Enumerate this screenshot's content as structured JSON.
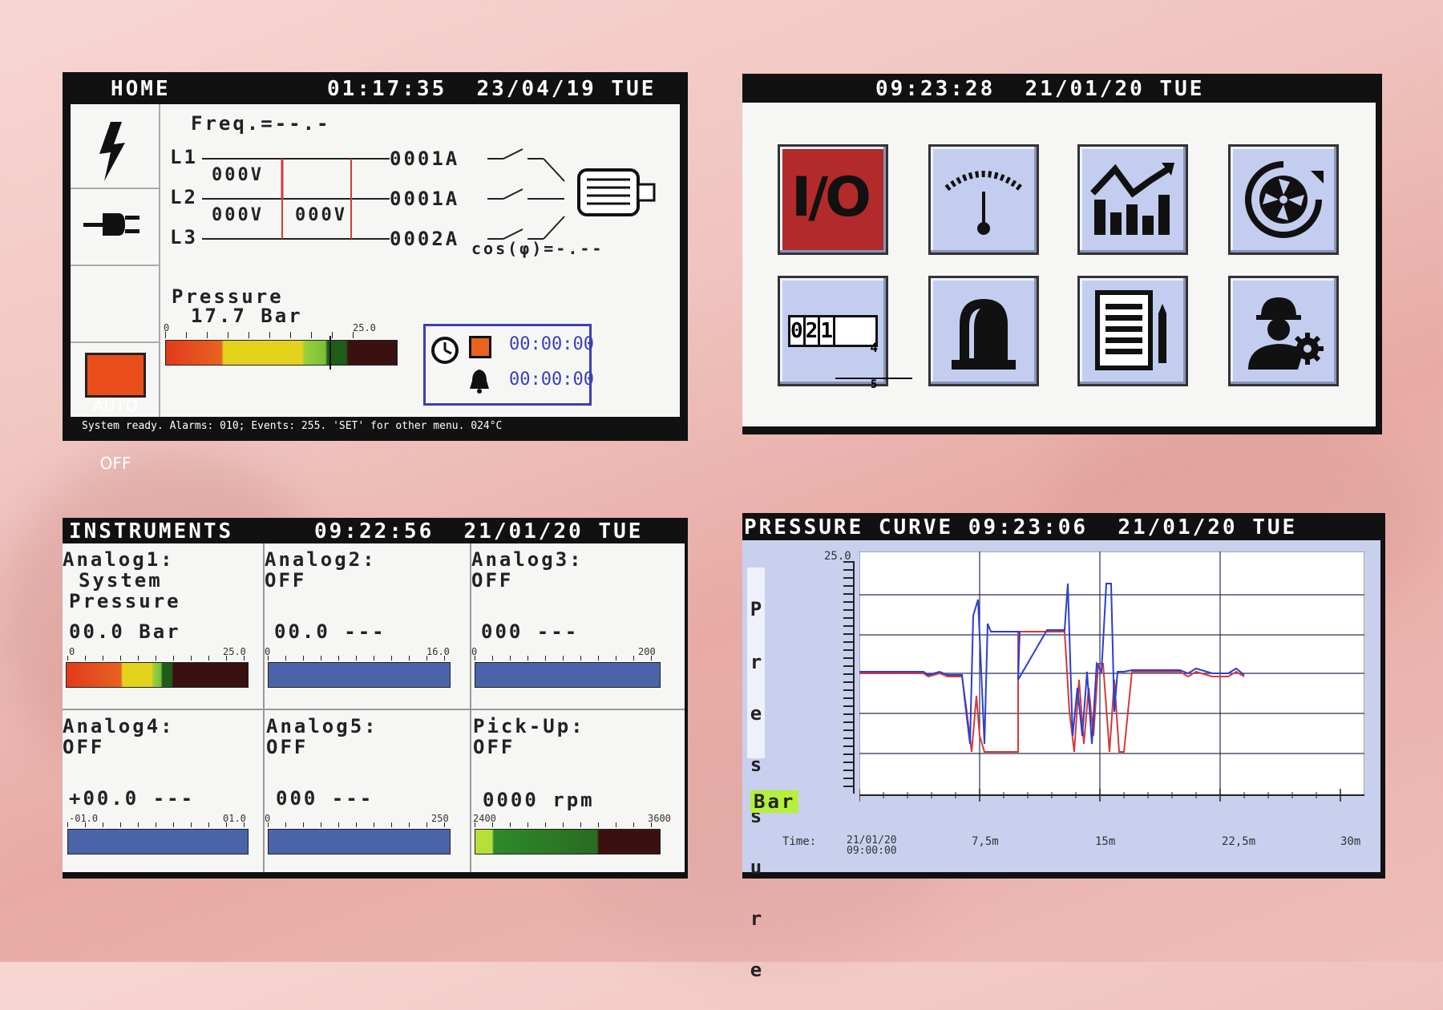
{
  "home": {
    "title": "HOME",
    "clock": "01:17:35  23/04/19 TUE",
    "freq": "Freq.=--.-",
    "l1": "L1",
    "l2": "L2",
    "l3": "L3",
    "v12": "000V",
    "v23": "000V",
    "v31": "000V",
    "i1": "0001A",
    "i2": "0001A",
    "i3": "0002A",
    "cosphi": "cos(φ)=-.--",
    "pressure_label": "Pressure",
    "pressure_value": "17.7 Bar",
    "gauge_min": "0",
    "gauge_max": "25.0",
    "gauge_level": 0.708,
    "auto_label": "AUTO",
    "off_label": "OFF",
    "timer1": "00:00:00",
    "timer2": "00:00:00",
    "status_bar": "System ready. Alarms: 010; Events: 255. 'SET' for other menu. 024°C"
  },
  "menu": {
    "clock": "09:23:28  21/01/20 TUE",
    "io_label": "I/O",
    "counter_digits": [
      "0",
      "2",
      "1",
      "4"
    ],
    "counter_sub": "5",
    "icons": [
      "io-icon",
      "gauge-icon",
      "chart-icon",
      "fan-icon",
      "counter-icon",
      "alarm-beacon-icon",
      "report-icon",
      "technician-gear-icon"
    ]
  },
  "instruments": {
    "title": "INSTRUMENTS",
    "clock": "09:22:56  21/01/20 TUE",
    "cells": [
      {
        "name": "Analog1:",
        "sub1": "System",
        "sub2": "Pressure",
        "value": "00.0 Bar",
        "min": "0",
        "max": "25.0"
      },
      {
        "name": "Analog2:",
        "sub1": "OFF",
        "sub2": "",
        "value": "00.0 ---",
        "min": "0",
        "max": "16.0"
      },
      {
        "name": "Analog3:",
        "sub1": "OFF",
        "sub2": "",
        "value": "000 ---",
        "min": "0",
        "max": "200"
      },
      {
        "name": "Analog4:",
        "sub1": "OFF",
        "sub2": "",
        "value": "+00.0 ---",
        "min": "-01.0",
        "max": "01.0"
      },
      {
        "name": "Analog5:",
        "sub1": "OFF",
        "sub2": "",
        "value": "000 ---",
        "min": "0",
        "max": "250"
      },
      {
        "name": "Pick-Up:",
        "sub1": "OFF",
        "sub2": "",
        "value": "0000 rpm",
        "min": "2400",
        "max": "3600"
      }
    ]
  },
  "curve": {
    "title": "PRESSURE CURVE 09:23:06  21/01/20 TUE",
    "ylabel_letters": [
      "P",
      "r",
      "e",
      "s",
      "s",
      "u",
      "r",
      "e"
    ],
    "unit": "Bar",
    "ymax_label": "25.0",
    "time_label": "Time:",
    "x_labels": [
      "21/01/20\n09:00:00",
      "7,5m",
      "15m",
      "22,5m",
      "30m"
    ],
    "colors": {
      "series_red": "#d23a3a",
      "series_blue": "#2a3fd0"
    }
  }
}
